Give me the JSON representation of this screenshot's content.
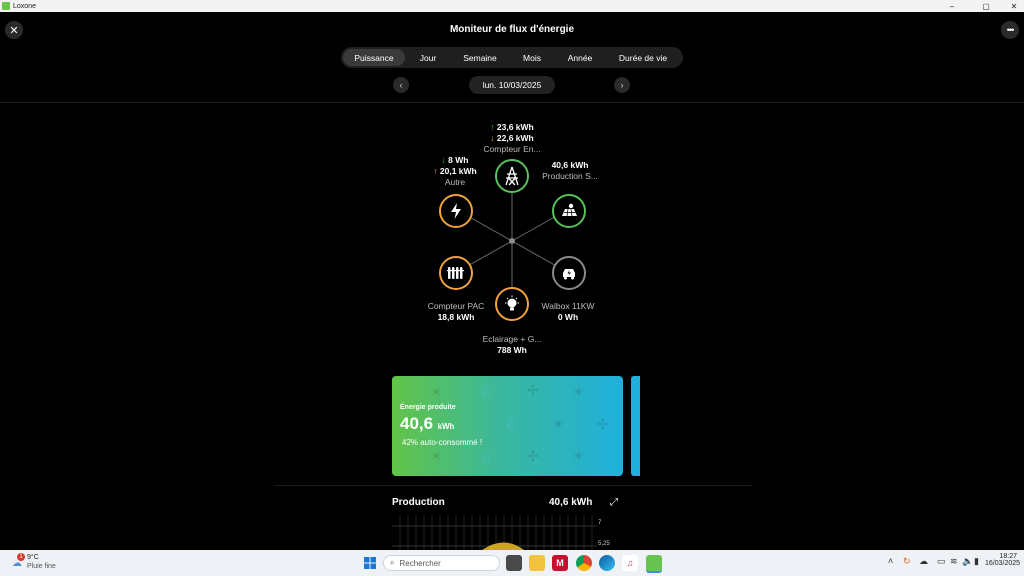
{
  "window": {
    "app_name": "Loxone",
    "controls": [
      "–",
      "▢",
      "✕"
    ]
  },
  "header": {
    "title": "Moniteur de flux d'énergie",
    "close_icon": "close-icon",
    "more_icon": "more-horizontal-icon"
  },
  "tabs": [
    {
      "label": "Puissance",
      "active": true
    },
    {
      "label": "Jour",
      "active": false
    },
    {
      "label": "Semaine",
      "active": false
    },
    {
      "label": "Mois",
      "active": false
    },
    {
      "label": "Année",
      "active": false
    },
    {
      "label": "Durée de vie",
      "active": false
    }
  ],
  "date": {
    "label": "lun. 10/03/2025",
    "prev_icon": "chevron-left-icon",
    "next_icon": "chevron-right-icon"
  },
  "flow": {
    "grid": {
      "up": "23,6 kWh",
      "down": "22,6 kWh",
      "name": "Compteur En...",
      "icon": "power-pylon-icon",
      "color": "#56c158"
    },
    "solar": {
      "value": "40,6 kWh",
      "name": "Production S...",
      "icon": "solar-panel-icon",
      "color": "#56c158"
    },
    "other": {
      "down": "8 Wh",
      "up": "20,1 kWh",
      "name": "Autre",
      "icon": "lightning-icon",
      "color": "#f0a13c"
    },
    "heatpump": {
      "name": "Compteur PAC",
      "value": "18,8 kWh",
      "icon": "radiator-icon",
      "color": "#f0a13c"
    },
    "wallbox": {
      "name": "Walbox 11KW",
      "value": "0 Wh",
      "icon": "car-charger-icon",
      "color": "#8a8a8a"
    },
    "lighting": {
      "name": "Eclairage + G...",
      "value": "788 Wh",
      "icon": "light-bulb-icon",
      "color": "#f0a13c"
    }
  },
  "energy_card": {
    "title": "Énergie produite",
    "value": "40,6",
    "unit": "kWh",
    "subtitle": "42% auto-consommé !"
  },
  "production": {
    "title": "Production",
    "value": "40,6 kWh",
    "expand_icon": "expand-icon",
    "axis_labels": [
      "7",
      "5,25"
    ]
  },
  "taskbar": {
    "weather_temp": "9°C",
    "weather_desc": "Pluie fine",
    "weather_badge": "1",
    "search_placeholder": "Rechercher",
    "time": "18:27",
    "date": "16/03/2025"
  }
}
